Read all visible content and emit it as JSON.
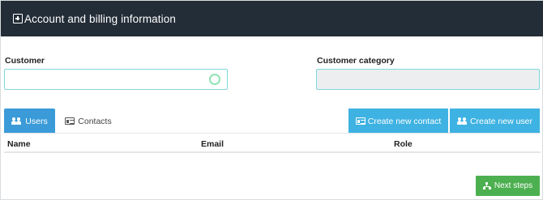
{
  "header": {
    "title": "Account and billing information",
    "icon": "plus-square-icon"
  },
  "form": {
    "customer": {
      "label": "Customer",
      "value": "",
      "loading": true
    },
    "customer_category": {
      "label": "Customer category",
      "value": "",
      "disabled": true
    }
  },
  "tabs": [
    {
      "label": "Users",
      "icon": "users-icon",
      "active": true
    },
    {
      "label": "Contacts",
      "icon": "contact-card-icon",
      "active": false
    }
  ],
  "actions": {
    "create_contact": {
      "label": "Create new contact",
      "icon": "contact-card-icon"
    },
    "create_user": {
      "label": "Create new user",
      "icon": "users-icon"
    }
  },
  "table": {
    "columns": [
      "Name",
      "Email",
      "Role"
    ],
    "rows": []
  },
  "footer": {
    "next_label": "Next steps",
    "icon": "sitemap-icon"
  },
  "colors": {
    "header_bg": "#232d37",
    "tab_active": "#3b9bd9",
    "action_button": "#3eb2e2",
    "next_button": "#4caf50",
    "input_border": "#7fd7dd"
  }
}
